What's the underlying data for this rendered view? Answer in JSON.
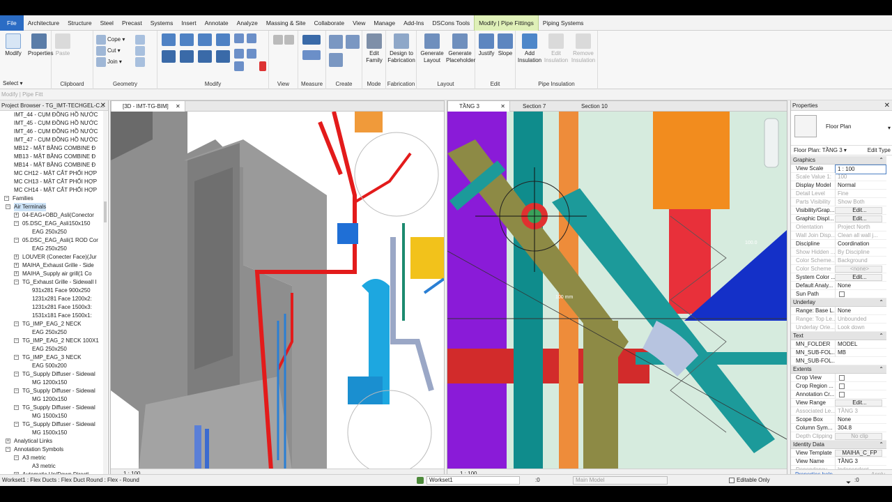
{
  "tabs": [
    "File",
    "Architecture",
    "Structure",
    "Steel",
    "Precast",
    "Systems",
    "Insert",
    "Annotate",
    "Analyze",
    "Massing & Site",
    "Collaborate",
    "View",
    "Manage",
    "Add-Ins",
    "DSCons Tools",
    "Modify | Pipe Fittings",
    "Piping Systems"
  ],
  "ribbon": {
    "select": {
      "modify": "Modify",
      "select_label": "Select"
    },
    "properties": "Properties",
    "clipboard": {
      "paste": "Paste",
      "cope": "Cope",
      "cut": "Cut",
      "join": "Join",
      "label": "Clipboard"
    },
    "geometry_label": "Geometry",
    "modify_label": "Modify",
    "view_label": "View",
    "measure_label": "Measure",
    "create_label": "Create",
    "mode": {
      "edit_family": "Edit Family",
      "label": "Mode"
    },
    "fabrication": {
      "design": "Design to Fabrication",
      "label": "Fabrication"
    },
    "layout": {
      "generate_layout": "Generate Layout",
      "generate_placeholder": "Generate Placeholder",
      "label": "Layout"
    },
    "edit": {
      "justify": "Justify",
      "slope": "Slope",
      "label": "Edit"
    },
    "insulation": {
      "add": "Add Insulation",
      "edit": "Edit Insulation",
      "remove": "Remove Insulation",
      "label": "Pipe Insulation"
    }
  },
  "modify_hint": "Modify | Pipe Fitt",
  "browser": {
    "title": "Project Browser - TG_IMT-TECHGEL-C...",
    "items": [
      {
        "t": "IMT_44 - CỤM ĐỒNG HỒ NƯỚC",
        "lv": 1,
        "tog": ""
      },
      {
        "t": "IMT_45 - CỤM ĐỒNG HỒ NƯỚC",
        "lv": 1,
        "tog": ""
      },
      {
        "t": "IMT_46 - CỤM ĐỒNG HỒ NƯỚC",
        "lv": 1,
        "tog": ""
      },
      {
        "t": "IMT_47 - CỤM ĐỒNG HỒ NƯỚC",
        "lv": 1,
        "tog": ""
      },
      {
        "t": "MB12 - MẶT BẰNG COMBINE Đ",
        "lv": 1,
        "tog": ""
      },
      {
        "t": "MB13 - MẶT BẰNG COMBINE Đ",
        "lv": 1,
        "tog": ""
      },
      {
        "t": "MB14 - MẶT BẰNG COMBINE Đ",
        "lv": 1,
        "tog": ""
      },
      {
        "t": "MC CH12 - MẶT CẮT PHỐI HỢP",
        "lv": 1,
        "tog": ""
      },
      {
        "t": "MC CH13 - MẶT CẮT PHỐI HỢP",
        "lv": 1,
        "tog": ""
      },
      {
        "t": "MC CH14 - MẶT CẮT PHỐI HỢP",
        "lv": 1,
        "tog": ""
      },
      {
        "t": "Families",
        "lv": 0,
        "tog": "−"
      },
      {
        "t": "Air Terminals",
        "lv": 1,
        "tog": "−",
        "sel": true
      },
      {
        "t": "04-EAG+OBD_Asli(Conector",
        "lv": 2,
        "tog": "+"
      },
      {
        "t": "05.DSC_EAG_Asli150x150",
        "lv": 2,
        "tog": "−"
      },
      {
        "t": "EAG 250x250",
        "lv": 3,
        "tog": ""
      },
      {
        "t": "05.DSC_EAG_Asli(1 ROD Cor",
        "lv": 2,
        "tog": "−"
      },
      {
        "t": "EAG 250x250",
        "lv": 3,
        "tog": ""
      },
      {
        "t": "LOUVER (Conecter Face)(Jur",
        "lv": 2,
        "tog": "+"
      },
      {
        "t": "MAIHA_Exhaust Grille - Side",
        "lv": 2,
        "tog": "+"
      },
      {
        "t": "MAIHA_Supply air grill(1 Co",
        "lv": 2,
        "tog": "+"
      },
      {
        "t": "TG_Exhaust Grille - Sidewall I",
        "lv": 2,
        "tog": "−"
      },
      {
        "t": "931x281 Face 900x250",
        "lv": 3,
        "tog": ""
      },
      {
        "t": "1231x281 Face 1200x2:",
        "lv": 3,
        "tog": ""
      },
      {
        "t": "1231x281 Face 1500x3:",
        "lv": 3,
        "tog": ""
      },
      {
        "t": "1531x181 Face 1500x1:",
        "lv": 3,
        "tog": ""
      },
      {
        "t": "TG_IMP_EAG_2 NECK",
        "lv": 2,
        "tog": "−"
      },
      {
        "t": "EAG 250x250",
        "lv": 3,
        "tog": ""
      },
      {
        "t": "TG_IMP_EAG_2 NECK 100X1",
        "lv": 2,
        "tog": "−"
      },
      {
        "t": "EAG 250x250",
        "lv": 3,
        "tog": ""
      },
      {
        "t": "TG_IMP_EAG_3 NECK",
        "lv": 2,
        "tog": "−"
      },
      {
        "t": "EAG 500x200",
        "lv": 3,
        "tog": ""
      },
      {
        "t": "TG_Supply Diffuser - Sidewal",
        "lv": 2,
        "tog": "−"
      },
      {
        "t": "MG 1200x150",
        "lv": 3,
        "tog": ""
      },
      {
        "t": "TG_Supply Diffuser - Sidewal",
        "lv": 2,
        "tog": "−"
      },
      {
        "t": "MG 1200x150",
        "lv": 3,
        "tog": ""
      },
      {
        "t": "TG_Supply Diffuser - Sidewal",
        "lv": 2,
        "tog": "−"
      },
      {
        "t": "MG 1500x150",
        "lv": 3,
        "tog": ""
      },
      {
        "t": "TG_Supply Diffuser - Sidewal",
        "lv": 2,
        "tog": "−"
      },
      {
        "t": "MG 1500x150",
        "lv": 3,
        "tog": ""
      },
      {
        "t": "Analytical Links",
        "lv": 1,
        "tog": "+"
      },
      {
        "t": "Annotation Symbols",
        "lv": 1,
        "tog": "−"
      },
      {
        "t": "A3 metric",
        "lv": 2,
        "tog": "−"
      },
      {
        "t": "A3 metric",
        "lv": 3,
        "tog": ""
      },
      {
        "t": "Automatic Up/Down Directi",
        "lv": 2,
        "tog": "−"
      }
    ]
  },
  "view3d": {
    "tab": "[3D - IMT-TG-BIM]",
    "scale": "1 : 100"
  },
  "view2d": {
    "tabs": [
      "TẦNG 3",
      "Section 7",
      "Section 10"
    ],
    "scale": "1 : 100",
    "dim1": "100 mm",
    "dim2": "100.0"
  },
  "properties": {
    "title": "Properties",
    "type_name": "Floor Plan",
    "selector": "Floor Plan: TẦNG 3",
    "edit_type": "Edit Type",
    "groups": [
      {
        "name": "Graphics",
        "rows": [
          {
            "k": "View Scale",
            "v": "1 : 100",
            "kind": "input"
          },
          {
            "k": "Scale Value  1:",
            "v": "100",
            "dim": true
          },
          {
            "k": "Display Model",
            "v": "Normal"
          },
          {
            "k": "Detail Level",
            "v": "Fine",
            "dim": true
          },
          {
            "k": "Parts Visibility",
            "v": "Show Both",
            "dim": true
          },
          {
            "k": "Visibility/Grap...",
            "v": "Edit...",
            "kind": "btn"
          },
          {
            "k": "Graphic Displ...",
            "v": "Edit...",
            "kind": "btn"
          },
          {
            "k": "Orientation",
            "v": "Project North",
            "dim": true
          },
          {
            "k": "Wall Join Disp...",
            "v": "Clean all wall j...",
            "dim": true
          },
          {
            "k": "Discipline",
            "v": "Coordination"
          },
          {
            "k": "Show Hidden ...",
            "v": "By Discipline",
            "dim": true
          },
          {
            "k": "Color Scheme...",
            "v": "Background",
            "dim": true
          },
          {
            "k": "Color Scheme",
            "v": "<none>",
            "dim": true,
            "kind": "btn"
          },
          {
            "k": "System Color ...",
            "v": "Edit...",
            "kind": "btn"
          },
          {
            "k": "Default Analy...",
            "v": "None"
          },
          {
            "k": "Sun Path",
            "v": "",
            "kind": "cb"
          }
        ]
      },
      {
        "name": "Underlay",
        "rows": [
          {
            "k": "Range: Base L...",
            "v": "None"
          },
          {
            "k": "Range: Top Le...",
            "v": "Unbounded",
            "dim": true
          },
          {
            "k": "Underlay Orie...",
            "v": "Look down",
            "dim": true
          }
        ]
      },
      {
        "name": "Text",
        "rows": [
          {
            "k": "MN_FOLDER",
            "v": "MODEL"
          },
          {
            "k": "MN_SUB-FOL...",
            "v": "MB"
          },
          {
            "k": "MN_SUB-FOL...",
            "v": ""
          }
        ]
      },
      {
        "name": "Extents",
        "rows": [
          {
            "k": "Crop View",
            "v": "",
            "kind": "cb"
          },
          {
            "k": "Crop Region ...",
            "v": "",
            "kind": "cb"
          },
          {
            "k": "Annotation Cr...",
            "v": "",
            "kind": "cb"
          },
          {
            "k": "View Range",
            "v": "Edit...",
            "kind": "btn"
          },
          {
            "k": "Associated Le...",
            "v": "TẦNG 3",
            "dim": true
          },
          {
            "k": "Scope Box",
            "v": "None"
          },
          {
            "k": "Column Sym...",
            "v": "304.8"
          },
          {
            "k": "Depth Clipping",
            "v": "No clip",
            "dim": true,
            "kind": "btn"
          }
        ]
      },
      {
        "name": "Identity Data",
        "rows": [
          {
            "k": "View Template",
            "v": "MAIHA_C_FP",
            "kind": "btn"
          },
          {
            "k": "View Name",
            "v": "TẦNG 3"
          },
          {
            "k": "Dependency",
            "v": "Independent",
            "dim": true
          },
          {
            "k": "Title on Sheet",
            "v": ""
          }
        ]
      }
    ],
    "help": "Properties help",
    "apply": "Apply"
  },
  "status": {
    "message": "Workset1 : Flex Ducts : Flex Duct Round : Flex - Round",
    "workset": "Workset1",
    "zero": ":0",
    "model": "Main Model",
    "editable": "Editable Only",
    "filter": ":0"
  }
}
